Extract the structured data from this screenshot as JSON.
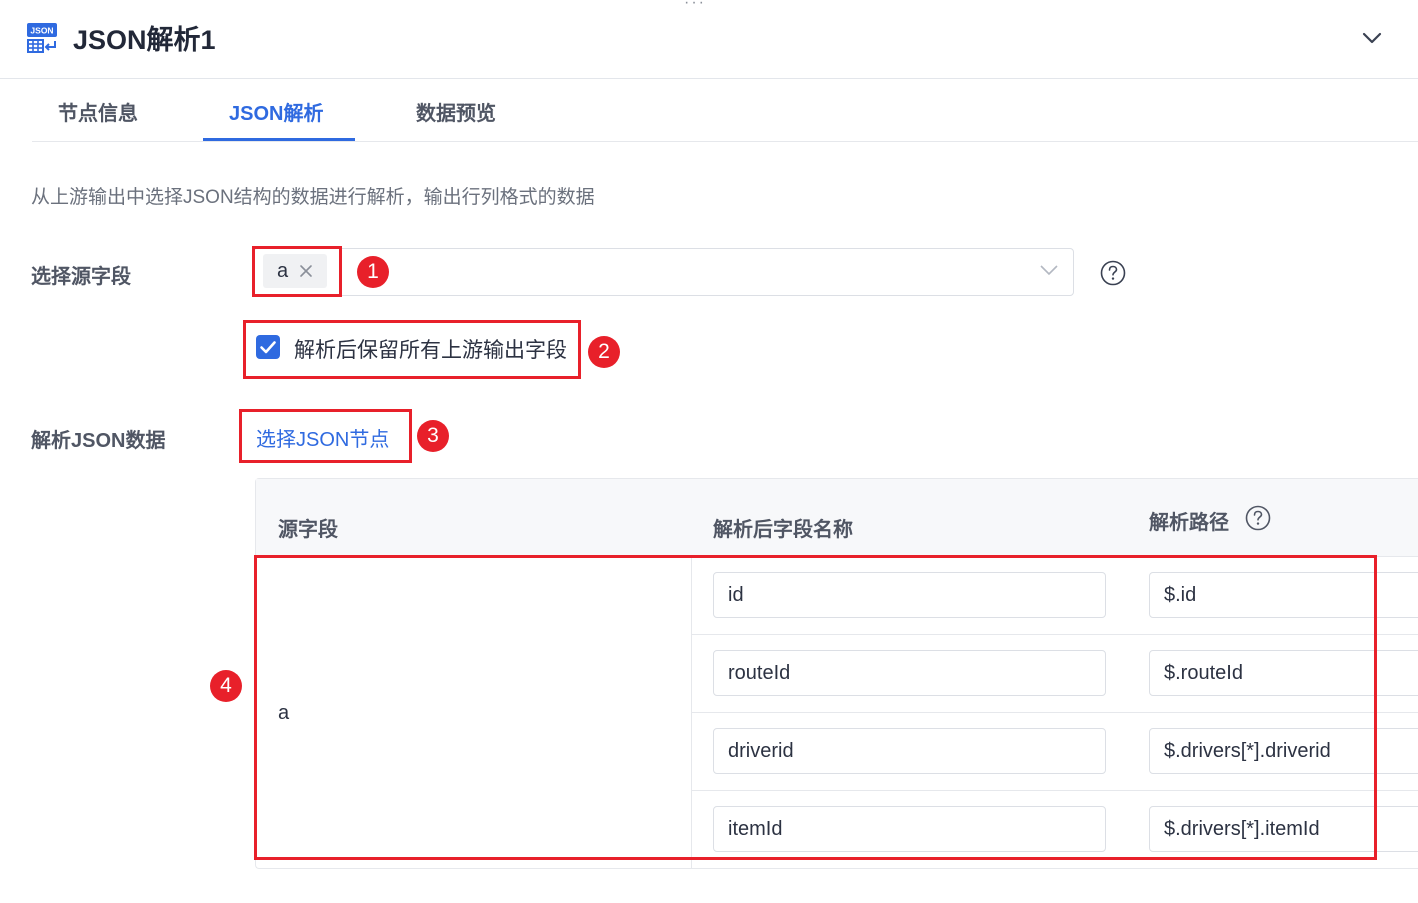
{
  "header": {
    "drag_handle": "···",
    "icon_badge": "JSON",
    "title": "JSON解析1"
  },
  "tabs": [
    {
      "label": "节点信息",
      "active": false
    },
    {
      "label": "JSON解析",
      "active": true
    },
    {
      "label": "数据预览",
      "active": false
    }
  ],
  "description": "从上游输出中选择JSON结构的数据进行解析，输出行列格式的数据",
  "source_field": {
    "label": "选择源字段",
    "selected_tags": [
      "a"
    ],
    "help_icon": "question-circle-icon"
  },
  "keep_fields": {
    "label": "解析后保留所有上游输出字段",
    "checked": true
  },
  "parse_json": {
    "label": "解析JSON数据",
    "link": "选择JSON节点"
  },
  "table": {
    "headers": {
      "source": "源字段",
      "name": "解析后字段名称",
      "path": "解析路径"
    },
    "source_value": "a",
    "rows": [
      {
        "name": "id",
        "path": "$.id"
      },
      {
        "name": "routeId",
        "path": "$.routeId"
      },
      {
        "name": "driverid",
        "path": "$.drivers[*].driverid"
      },
      {
        "name": "itemId",
        "path": "$.drivers[*].itemId"
      }
    ]
  },
  "annotations": [
    "1",
    "2",
    "3",
    "4"
  ],
  "colors": {
    "accent": "#2f6ae0",
    "annotation": "#e8202a",
    "text": "#2c3242",
    "muted": "#6b717d"
  }
}
